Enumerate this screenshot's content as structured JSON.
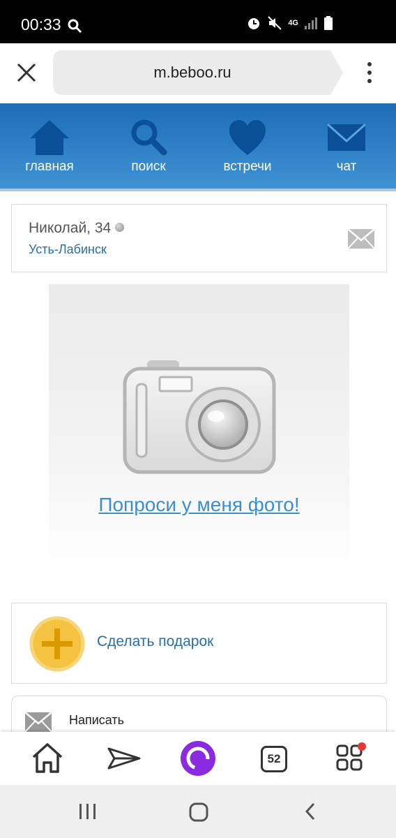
{
  "status_bar": {
    "time": "00:33",
    "network": "4G"
  },
  "browser": {
    "url": "m.beboo.ru"
  },
  "nav": {
    "items": [
      {
        "label": "главная",
        "icon": "home-icon"
      },
      {
        "label": "поиск",
        "icon": "search-icon"
      },
      {
        "label": "встречи",
        "icon": "heart-icon"
      },
      {
        "label": "чат",
        "icon": "envelope-icon"
      }
    ]
  },
  "profile": {
    "name": "Николай, 34",
    "city": "Усть-Лабинск"
  },
  "photo": {
    "request_link": "Попроси у меня фото!"
  },
  "actions": {
    "gift_label": "Сделать подарок",
    "write_label": "Написать"
  },
  "toolbar": {
    "tab_count": "52"
  },
  "colors": {
    "nav_top": "#1b6db6",
    "nav_bottom": "#3f93d3",
    "link": "#2a6ea6",
    "photo_link": "#3a8fd0",
    "gift": "#f5c242"
  }
}
